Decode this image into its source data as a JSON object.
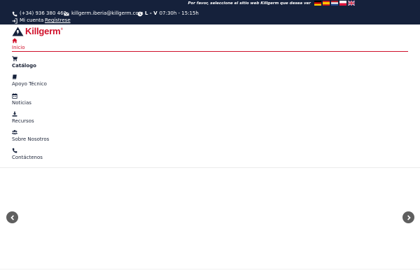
{
  "site_strip": {
    "prompt": "Por favor, seleccione el sitio web Killgerm que desea ver",
    "flags": [
      {
        "icon": "flag-germany-icon"
      },
      {
        "icon": "flag-spain-icon"
      },
      {
        "icon": "flag-netherlands-icon"
      },
      {
        "icon": "flag-poland-icon"
      },
      {
        "icon": "flag-uk-icon"
      }
    ]
  },
  "contact": {
    "phone": "(+34) 936 380 460",
    "email": "killgerm.iberia@killgerm.com",
    "hours_days": "L - V",
    "hours_time": "07:30h - 15:15h",
    "account_label": "Mi cuenta",
    "register_label": "Regístrese"
  },
  "logo": {
    "text": "Killgerm",
    "reg": "®"
  },
  "menu": {
    "items": [
      {
        "label": "Inicio",
        "icon": "home-icon"
      },
      {
        "label": "Catálogo",
        "icon": "cart-icon"
      },
      {
        "label": "Apoyo Técnico",
        "icon": "book-icon"
      },
      {
        "label": "Noticias",
        "icon": "calendar-icon"
      },
      {
        "label": "Recursos",
        "icon": "download-icon"
      },
      {
        "label": "Sobre Nosotros",
        "icon": "users-icon"
      },
      {
        "label": "Contáctenos",
        "icon": "phone-icon"
      }
    ]
  },
  "slider": {
    "prev_icon": "chevron-left-icon",
    "next_icon": "chevron-right-icon"
  },
  "colors": {
    "topbar": "#15213b",
    "accent": "#d0112b",
    "arrow": "#5f5f5f"
  }
}
